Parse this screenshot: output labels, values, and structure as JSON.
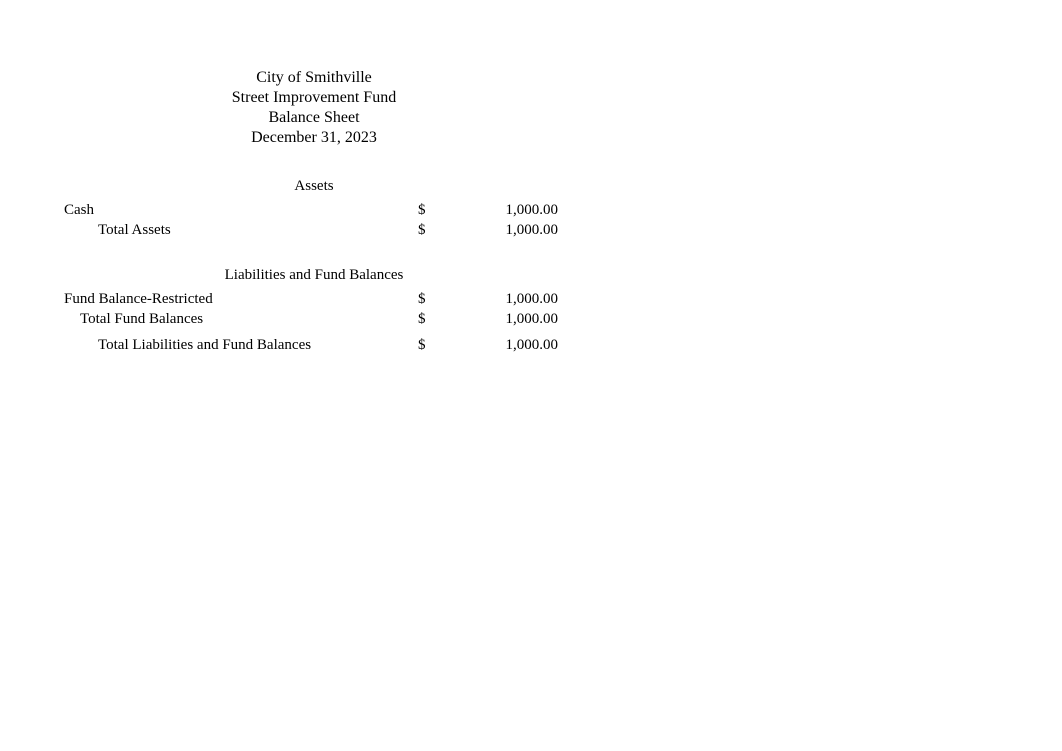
{
  "header": {
    "line1": "City of Smithville",
    "line2": "Street Improvement Fund",
    "line3": "Balance Sheet",
    "line4": "December 31, 2023"
  },
  "assets": {
    "title": "Assets",
    "rows": [
      {
        "label": "Cash",
        "currency": "$",
        "value": "1,000.00",
        "indent": 0
      },
      {
        "label": "Total Assets",
        "currency": "$",
        "value": "1,000.00",
        "indent": 1
      }
    ]
  },
  "liabilities": {
    "title": "Liabilities and Fund Balances",
    "rows": [
      {
        "label": "Fund Balance-Restricted",
        "currency": "$",
        "value": "1,000.00",
        "indent": 0
      },
      {
        "label": "Total Fund Balances",
        "currency": "$",
        "value": "1,000.00",
        "indent": 2
      },
      {
        "label": "Total Liabilities and Fund Balances",
        "currency": "$",
        "value": "1,000.00",
        "indent": 1
      }
    ]
  }
}
